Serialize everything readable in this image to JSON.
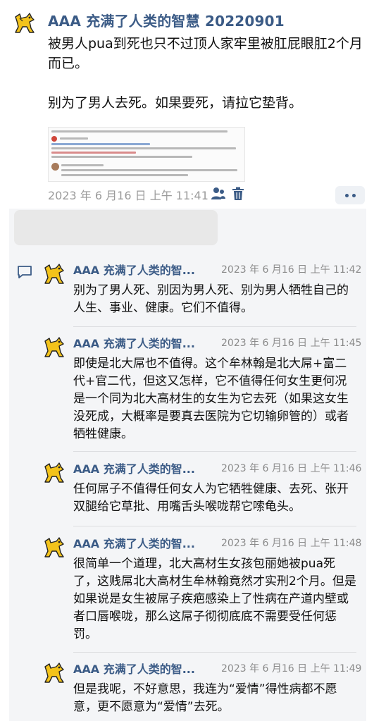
{
  "post": {
    "author": "AAA 充满了人类的智慧 20220901",
    "paragraphs": [
      "被男人pua到死也只不过顶人家牢里被肛屁眼肛2个月而已。",
      "别为了男人去死。如果要死，请拉它垫背。"
    ],
    "timestamp": "2023 年 6 月16 日 上午 11:41",
    "avatar_icon": "dog-avatar-icon",
    "share_icon": "person-share-icon",
    "delete_icon": "trash-icon",
    "more_icon": "more-dots-icon",
    "accent_color": "#3b5b86"
  },
  "comments_section": {
    "comment_icon": "speech-bubble-icon",
    "comments": [
      {
        "author": "AAA 充满了人类的智...",
        "time": "2023 年 6 月16 日 上午 11:42",
        "text": "别为了男人死、别因为男人死、别为男人牺牲自己的人生、事业、健康。它们不值得。"
      },
      {
        "author": "AAA 充满了人类的智...",
        "time": "2023 年 6 月16 日 上午 11:45",
        "text": "即使是北大屌也不值得。这个牟林翰是北大屌+富二代+官二代，但这又怎样，它不值得任何女生更何况是一个同为北大高材生的女生为它去死（如果这女生没死成，大概率是要真去医院为它切输卵管的）或者牺牲健康。"
      },
      {
        "author": "AAA 充满了人类的智...",
        "time": "2023 年 6 月16 日 上午 11:46",
        "text": "任何屌子不值得任何女人为它牺牲健康、去死、张开双腿给它草批、用嘴舌头喉咙帮它嗦龟头。"
      },
      {
        "author": "AAA 充满了人类的智...",
        "time": "2023 年 6 月16 日 上午 11:48",
        "text": "很简单一个道理，北大高材生女孩包丽她被pua死了，这贱屌北大高材生牟林翰竟然才实刑2个月。但是如果说是女生被屌子疾疤感染上了性病在产道内壁或者口唇喉咙，那么这屌子彻彻底底不需要受任何惩罚。"
      },
      {
        "author": "AAA 充满了人类的智...",
        "time": "2023 年 6 月16 日 上午 11:49",
        "text": "但是我呢，不好意思，我连为“爱情”得性病都不愿意，更不愿意为“爱情”去死。"
      }
    ]
  }
}
